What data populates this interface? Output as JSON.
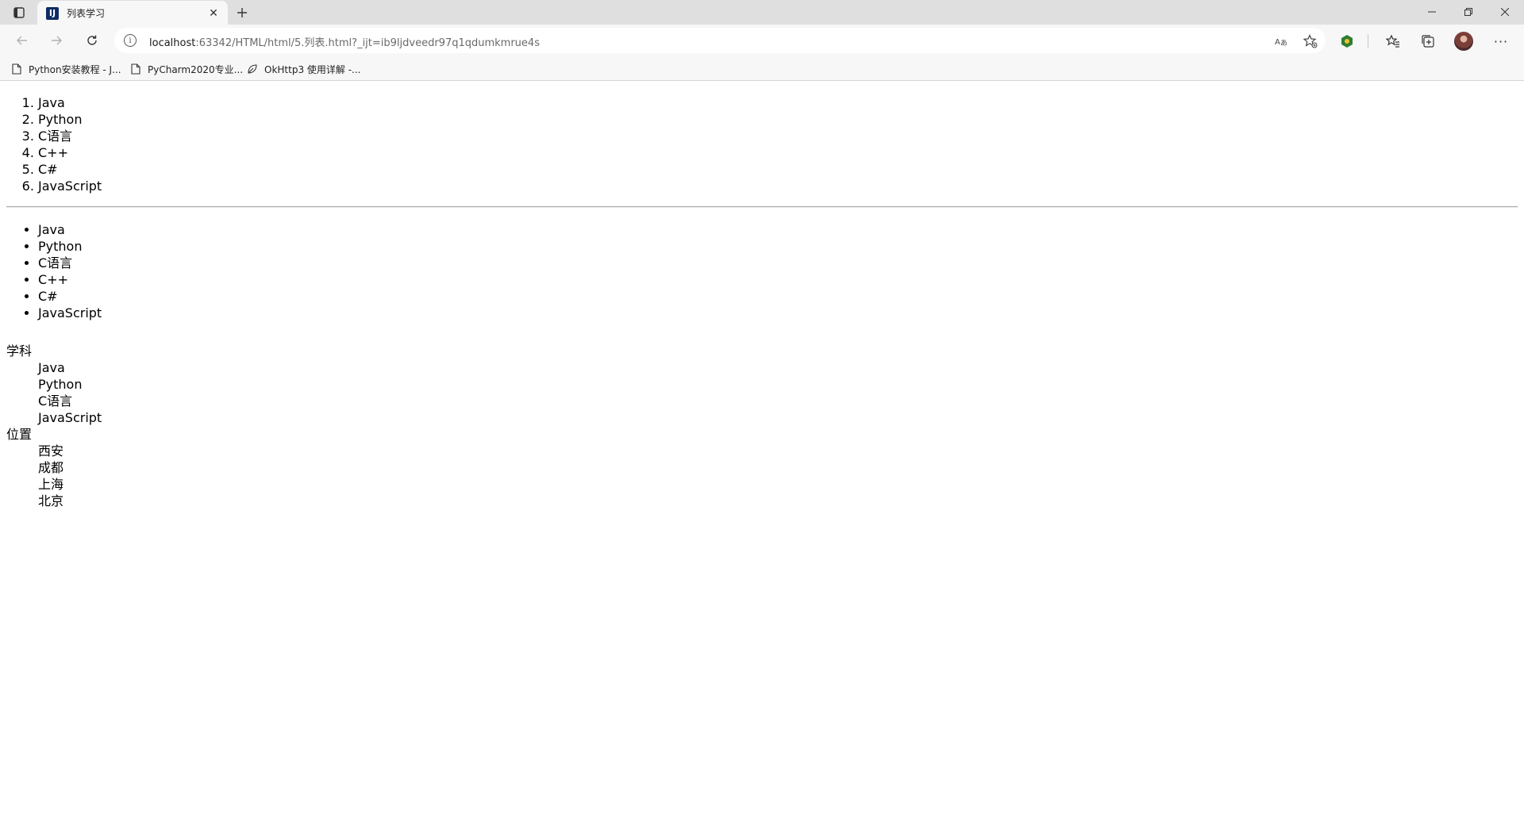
{
  "browser": {
    "tab": {
      "title": "列表学习",
      "favicon_glyph": "IJ"
    },
    "address_bar": {
      "host": "localhost",
      "path": ":63342/HTML/html/5.列表.html?_ijt=ib9ljdveedr97q1qdumkmrue4s"
    },
    "bookmarks": [
      {
        "label": "Python安装教程 - J..."
      },
      {
        "label": "PyCharm2020专业..."
      },
      {
        "label": "OkHttp3 使用详解 -..."
      }
    ]
  },
  "page": {
    "ordered_list": [
      "Java",
      "Python",
      "C语言",
      "C++",
      "C#",
      "JavaScript"
    ],
    "unordered_list": [
      "Java",
      "Python",
      "C语言",
      "C++",
      "C#",
      "JavaScript"
    ],
    "definition_list": [
      {
        "term": "学科",
        "descriptions": [
          "Java",
          "Python",
          "C语言",
          "JavaScript"
        ]
      },
      {
        "term": "位置",
        "descriptions": [
          "西安",
          "成都",
          "上海",
          "北京"
        ]
      }
    ]
  },
  "colors": {
    "chrome_bg": "#f7f7f7",
    "tabstrip_bg": "#dfdfdf",
    "favicon": "#0c2c63"
  }
}
